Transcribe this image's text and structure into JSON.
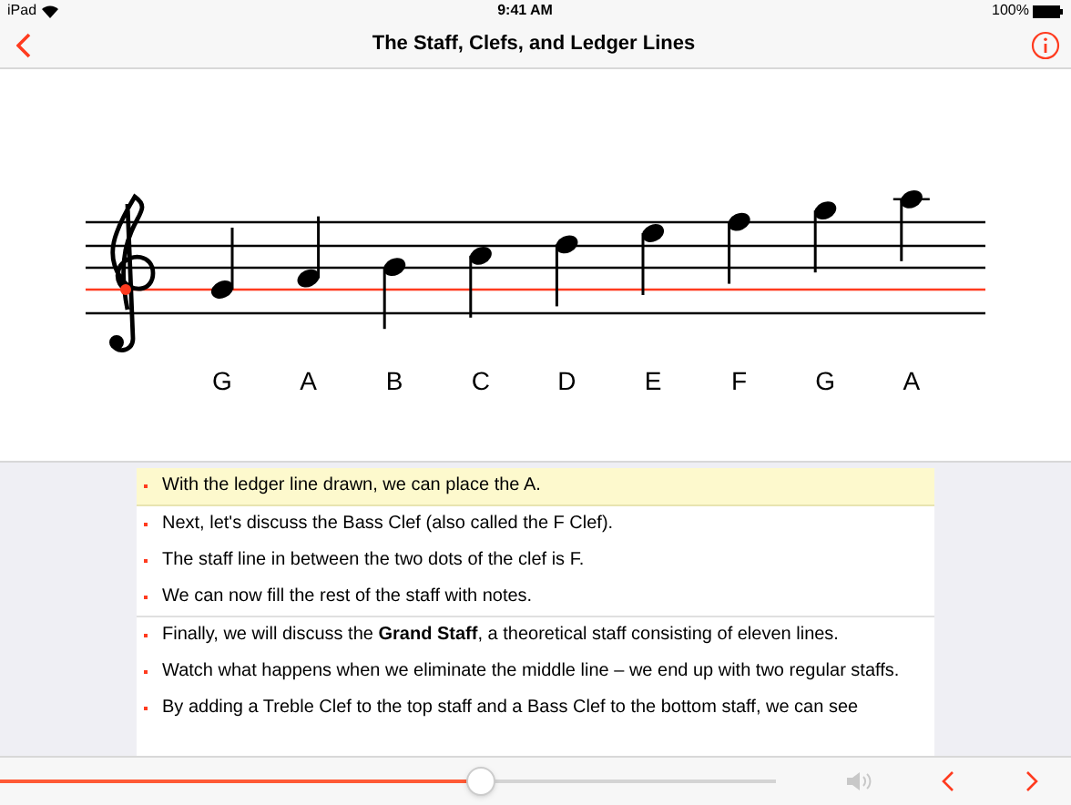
{
  "status_bar": {
    "device": "iPad",
    "time": "9:41 AM",
    "battery": "100%"
  },
  "nav": {
    "title": "The Staff, Clefs, and Ledger Lines"
  },
  "notes": [
    {
      "letter": "G"
    },
    {
      "letter": "A"
    },
    {
      "letter": "B"
    },
    {
      "letter": "C"
    },
    {
      "letter": "D"
    },
    {
      "letter": "E"
    },
    {
      "letter": "F"
    },
    {
      "letter": "G"
    },
    {
      "letter": "A"
    }
  ],
  "sections": [
    {
      "items": [
        {
          "text": "With the ledger line drawn, we can place the A.",
          "selected": true
        },
        {
          "text": "Next, let's discuss the Bass Clef (also called the F Clef).",
          "selected": false
        },
        {
          "text": "The staff line in between the two dots of the clef is F.",
          "selected": false
        },
        {
          "text": "We can now fill the rest of the staff with notes.",
          "selected": false
        }
      ]
    },
    {
      "items": [
        {
          "text": "Finally, we will discuss the **Grand Staff**, a theoretical staff consisting of eleven lines.",
          "selected": false
        },
        {
          "text": "Watch what happens when we eliminate the middle line – we end up with two regular staffs.",
          "selected": false
        },
        {
          "text": "By adding a Treble Clef to the top staff and a Bass Clef to the bottom staff, we can see",
          "selected": false
        }
      ]
    }
  ],
  "player": {
    "level": 0.62
  }
}
